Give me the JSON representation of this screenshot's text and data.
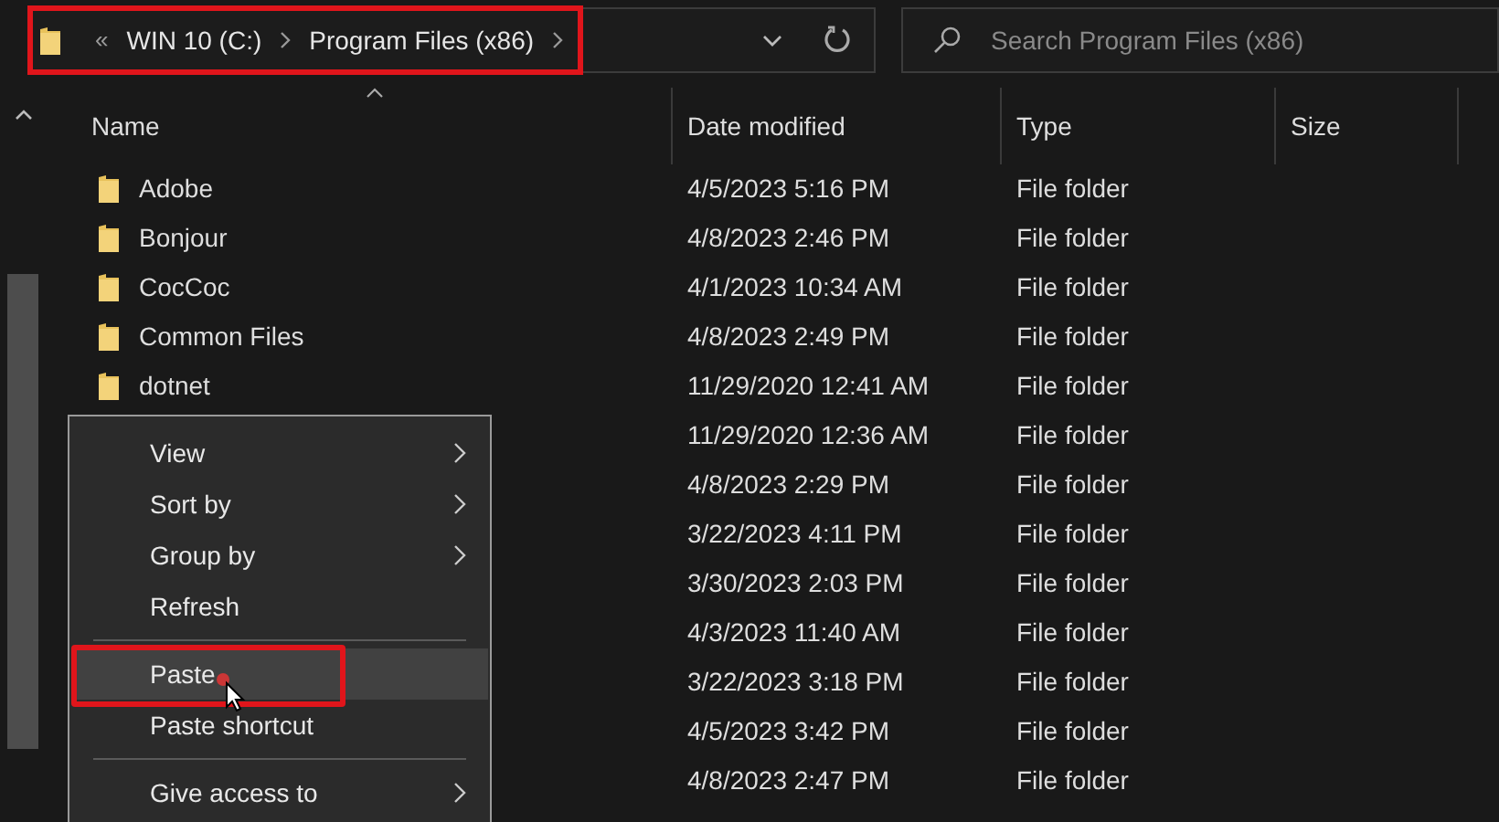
{
  "address_bar": {
    "highlighted": true,
    "overflow": "«",
    "crumbs": [
      "WIN 10 (C:)",
      "Program Files (x86)"
    ]
  },
  "search": {
    "placeholder": "Search Program Files (x86)"
  },
  "columns": [
    "Name",
    "Date modified",
    "Type",
    "Size"
  ],
  "rows": [
    {
      "name": "Adobe",
      "date": "4/5/2023 5:16 PM",
      "type": "File folder"
    },
    {
      "name": "Bonjour",
      "date": "4/8/2023 2:46 PM",
      "type": "File folder"
    },
    {
      "name": "CocCoc",
      "date": "4/1/2023 10:34 AM",
      "type": "File folder"
    },
    {
      "name": "Common Files",
      "date": "4/8/2023 2:49 PM",
      "type": "File folder"
    },
    {
      "name": "dotnet",
      "date": "11/29/2020 12:41 AM",
      "type": "File folder"
    },
    {
      "date": "11/29/2020 12:36 AM",
      "type": "File folder"
    },
    {
      "date": "4/8/2023 2:29 PM",
      "type": "File folder"
    },
    {
      "date": "3/22/2023 4:11 PM",
      "type": "File folder"
    },
    {
      "date": "3/30/2023 2:03 PM",
      "type": "File folder"
    },
    {
      "date": "4/3/2023 11:40 AM",
      "type": "File folder"
    },
    {
      "date": "3/22/2023 3:18 PM",
      "type": "File folder"
    },
    {
      "date": "4/5/2023 3:42 PM",
      "type": "File folder"
    },
    {
      "date": "4/8/2023 2:47 PM",
      "type": "File folder"
    }
  ],
  "context_menu": [
    {
      "kind": "item",
      "label": "View",
      "has_submenu": true,
      "selected": false,
      "highlighted": false
    },
    {
      "kind": "item",
      "label": "Sort by",
      "has_submenu": true,
      "selected": false,
      "highlighted": false
    },
    {
      "kind": "item",
      "label": "Group by",
      "has_submenu": true,
      "selected": false,
      "highlighted": false
    },
    {
      "kind": "item",
      "label": "Refresh",
      "has_submenu": false,
      "selected": false,
      "highlighted": false
    },
    {
      "kind": "separator"
    },
    {
      "kind": "item",
      "label": "Paste",
      "has_submenu": false,
      "selected": true,
      "highlighted": true
    },
    {
      "kind": "item",
      "label": "Paste shortcut",
      "has_submenu": false,
      "selected": false,
      "highlighted": false
    },
    {
      "kind": "separator"
    },
    {
      "kind": "item",
      "label": "Give access to",
      "has_submenu": true,
      "selected": false,
      "highlighted": false
    }
  ]
}
